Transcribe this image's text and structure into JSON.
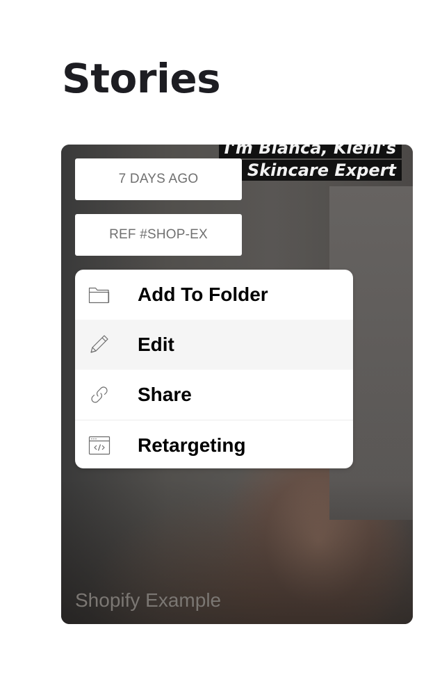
{
  "page": {
    "title": "Stories"
  },
  "story": {
    "caption_lines": [
      "I'm Bianca, Kiehl's",
      "Skincare Expert"
    ],
    "date_chip": "7 DAYS AGO",
    "ref_chip": "REF #SHOP-EX",
    "title": "Shopify Example"
  },
  "menu": {
    "items": [
      {
        "label": "Add To Folder",
        "icon": "folder-icon"
      },
      {
        "label": "Edit",
        "icon": "pencil-icon",
        "highlighted": true
      },
      {
        "label": "Share",
        "icon": "link-icon"
      },
      {
        "label": "Retargeting",
        "icon": "code-window-icon"
      }
    ]
  },
  "colors": {
    "title_text": "#1d1d22",
    "chip_text": "#707070",
    "menu_highlight": "#f5f5f5",
    "menu_label": "#000000",
    "story_title": "#7b7773"
  }
}
